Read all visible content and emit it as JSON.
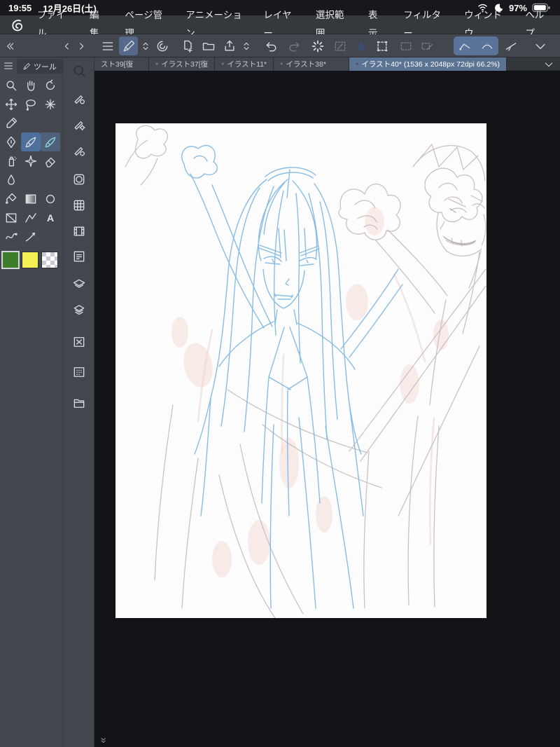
{
  "status_bar": {
    "time": "19:55",
    "date": "12月26日(土)",
    "battery_percent": "97%"
  },
  "menu_bar": {
    "items": [
      "ファイル",
      "編集",
      "ページ管理",
      "アニメーション",
      "レイヤー",
      "選択範囲",
      "表示",
      "フィルター",
      "ウィンドウ",
      "ヘルプ"
    ]
  },
  "document_tabs": {
    "items": [
      {
        "dot": "",
        "label": "スト39[復"
      },
      {
        "dot": "●",
        "label": "イラスト37[復"
      },
      {
        "dot": "●",
        "label": "イラスト11*"
      },
      {
        "dot": "●",
        "label": "イラスト38*"
      },
      {
        "dot": "●",
        "label": "イラスト40* (1536 x 2048px 72dpi 66.2%)"
      }
    ],
    "active_index": 4
  },
  "tool_panel": {
    "title": "ツール",
    "text_tool_glyph": "A"
  },
  "color_swatches": {
    "main_color": "#3e7d2c",
    "sub_color": "#f4ef53"
  },
  "theme": {
    "selection_blue": "#54719c",
    "active_tab_bg": "#5b7493",
    "toolbar_bg": "#43474d",
    "canvas_backdrop": "#121317",
    "paper_white": "#fdfdfd"
  }
}
